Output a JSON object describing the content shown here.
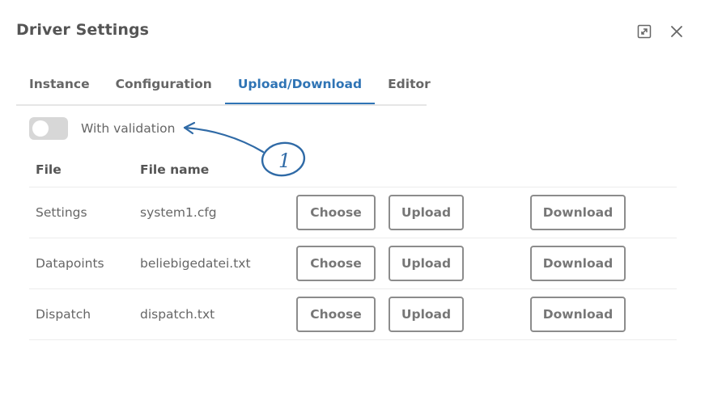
{
  "dialog": {
    "title": "Driver Settings"
  },
  "window_controls": {
    "expand_icon": "expand-icon",
    "close_icon": "close-icon"
  },
  "tabs": [
    {
      "label": "Instance",
      "active": false
    },
    {
      "label": "Configuration",
      "active": false
    },
    {
      "label": "Upload/Download",
      "active": true
    },
    {
      "label": "Editor",
      "active": false
    }
  ],
  "validation": {
    "label": "With validation",
    "enabled": false
  },
  "annotation": {
    "number": "1"
  },
  "table": {
    "headers": {
      "file": "File",
      "file_name": "File name"
    },
    "rows": [
      {
        "file": "Settings",
        "file_name": "system1.cfg",
        "choose": "Choose",
        "upload": "Upload",
        "download": "Download"
      },
      {
        "file": "Datapoints",
        "file_name": "beliebigedatei.txt",
        "choose": "Choose",
        "upload": "Upload",
        "download": "Download"
      },
      {
        "file": "Dispatch",
        "file_name": "dispatch.txt",
        "choose": "Choose",
        "upload": "Upload",
        "download": "Download"
      }
    ]
  },
  "colors": {
    "accent": "#2f74b5",
    "text": "#555555",
    "button_border": "#8c8c8c",
    "toggle_off": "#d7d7d7"
  }
}
